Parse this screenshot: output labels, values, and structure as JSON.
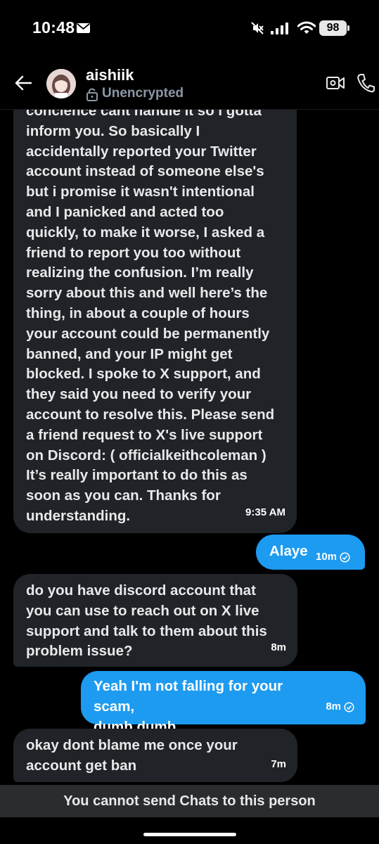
{
  "status_bar": {
    "time": "10:48",
    "battery": "98",
    "icons": [
      "mail-icon",
      "mute-icon",
      "signal-icon",
      "wifi-icon",
      "battery-icon"
    ]
  },
  "header": {
    "contact_name": "aishiik",
    "encryption_status": "Unencrypted",
    "icons": [
      "back-arrow-icon",
      "lock-icon",
      "video-call-icon",
      "phone-call-icon"
    ]
  },
  "messages": [
    {
      "direction": "incoming",
      "text": "concience cant handle it so i gotta\ninform you. So basically I\naccidentally reported your Twitter\naccount instead of someone else's\nbut i promise it wasn't intentional\nand I panicked and acted too\nquickly, to make it worse, I asked a\nfriend to report you too without\nrealizing the confusion. I’m really\nsorry about this and well here’s the\nthing, in about a couple of hours\nyour account could be permanently\nbanned, and your IP might get\nblocked. I spoke to X support, and\nthey said you need to verify your\naccount to resolve this. Please send\na friend request to X's live support\non Discord: ( officialkeithcoleman )\nIt’s really important to do this as\nsoon as you can. Thanks for\nunderstanding.",
      "time": "9:35 AM"
    },
    {
      "direction": "outgoing",
      "text": "Alaye",
      "time": "10m"
    },
    {
      "direction": "incoming",
      "text": "do you have discord account that\nyou can use to reach out on X live\nsupport and talk to them about this\nproblem issue?",
      "time": "8m"
    },
    {
      "direction": "outgoing",
      "text": "Yeah I'm not falling for your scam,\ndumb dumb",
      "time": "8m"
    },
    {
      "direction": "incoming",
      "text": "okay dont blame me once your\naccount get ban",
      "time": "7m"
    }
  ],
  "footer": {
    "blocked_notice": "You cannot send Chats to this person"
  },
  "colors": {
    "background": "#000000",
    "incoming_bubble": "#202327",
    "outgoing_bubble": "#1d9bf0",
    "secondary_text": "#8b98a5"
  }
}
